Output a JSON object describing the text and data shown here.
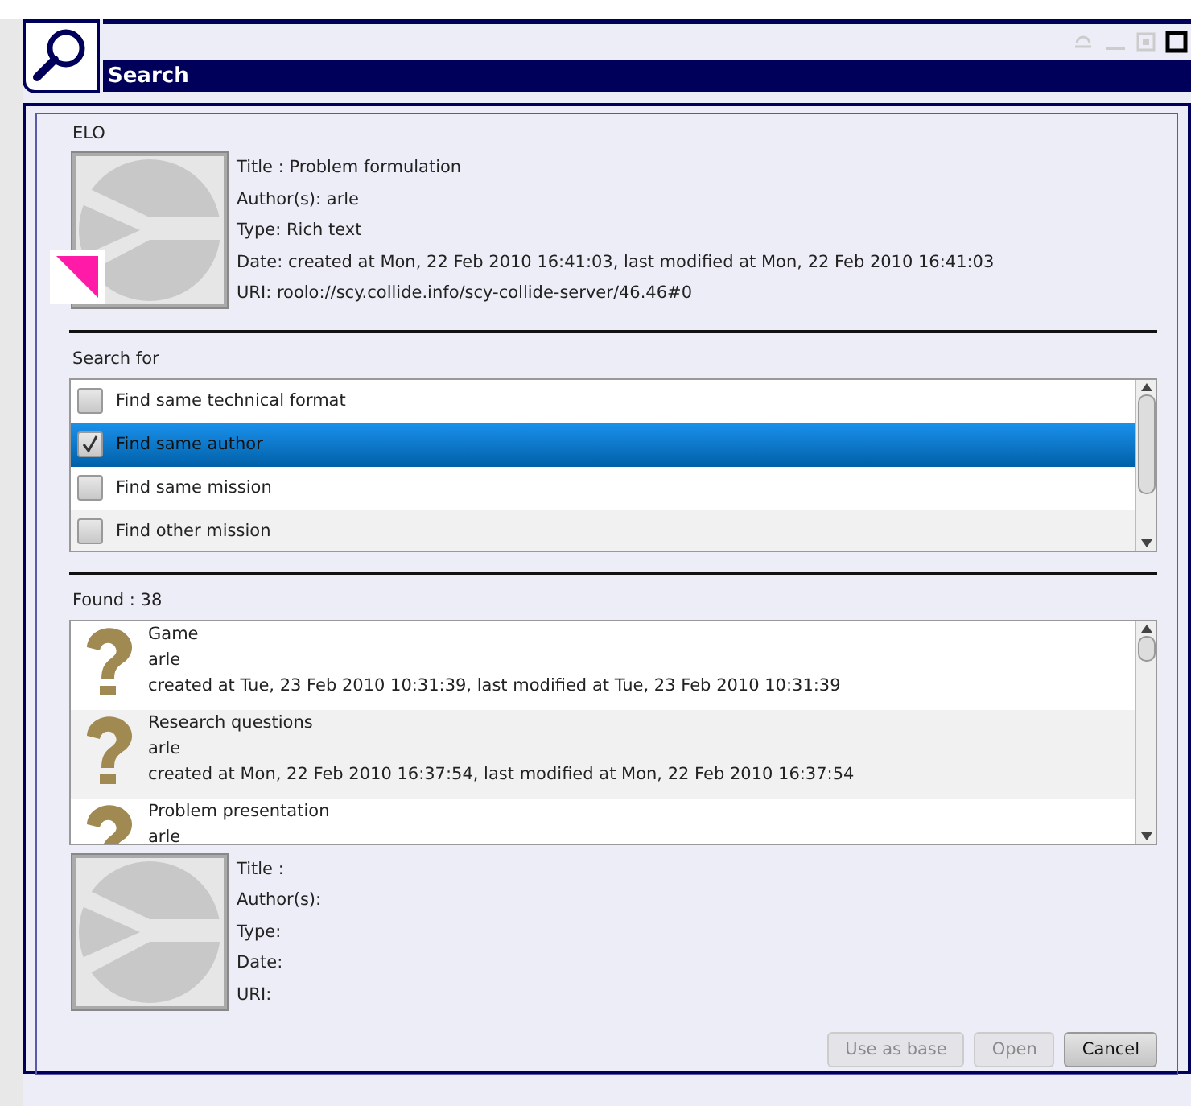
{
  "window": {
    "title": "Search"
  },
  "elo": {
    "heading": "ELO",
    "fields": [
      "Title : Problem formulation",
      "Author(s): arle",
      "Type: Rich text",
      "Date: created at Mon, 22 Feb 2010 16:41:03, last modified at Mon, 22 Feb 2010 16:41:03",
      "URI: roolo://scy.collide.info/scy-collide-server/46.46#0"
    ]
  },
  "search_for": {
    "heading": "Search for",
    "options": [
      {
        "label": "Find same technical format",
        "checked": false,
        "selected": false
      },
      {
        "label": "Find same author",
        "checked": true,
        "selected": true
      },
      {
        "label": "Find same mission",
        "checked": false,
        "selected": false
      },
      {
        "label": "Find other mission",
        "checked": false,
        "selected": false
      }
    ]
  },
  "results": {
    "heading": "Found : 38",
    "items": [
      {
        "title": "Game",
        "author": "arle",
        "dates": "created at Tue, 23 Feb 2010 10:31:39, last modified at Tue, 23 Feb 2010 10:31:39"
      },
      {
        "title": "Research questions",
        "author": "arle",
        "dates": "created at Mon, 22 Feb 2010 16:37:54, last modified at Mon, 22 Feb 2010 16:37:54"
      },
      {
        "title": "Problem presentation",
        "author": "arle"
      }
    ]
  },
  "preview": {
    "fields": [
      "Title :",
      "Author(s):",
      "Type:",
      "Date:",
      "URI:"
    ]
  },
  "buttons": [
    {
      "label": "Use as base",
      "disabled": true
    },
    {
      "label": "Open",
      "disabled": true
    },
    {
      "label": "Cancel",
      "disabled": false
    }
  ]
}
